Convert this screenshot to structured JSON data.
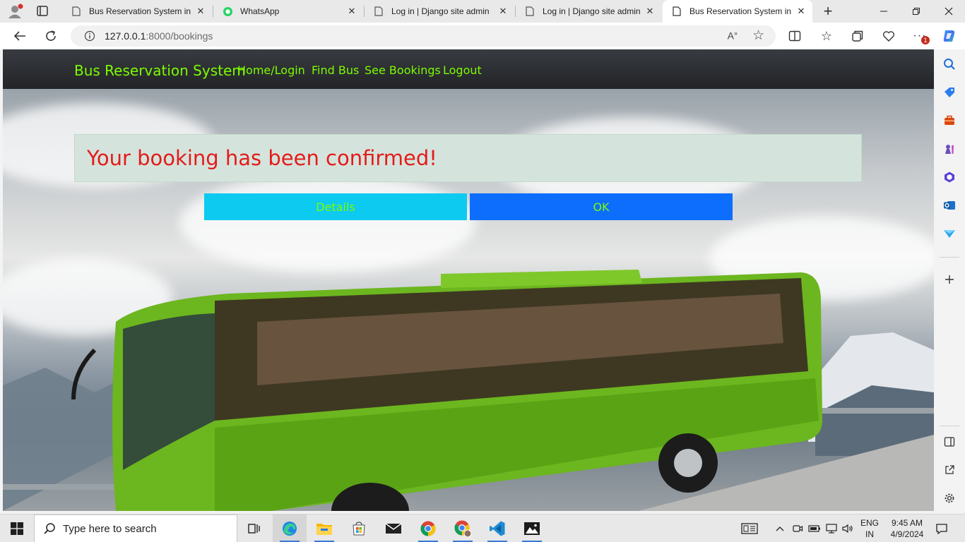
{
  "browser": {
    "tabs": [
      {
        "title": "Bus Reservation System in Dj",
        "icon": "page-icon",
        "active": false
      },
      {
        "title": "WhatsApp",
        "icon": "whatsapp-icon",
        "active": false
      },
      {
        "title": "Log in | Django site admin",
        "icon": "page-icon",
        "active": false
      },
      {
        "title": "Log in | Django site admin",
        "icon": "page-icon",
        "active": false
      },
      {
        "title": "Bus Reservation System in Dj",
        "icon": "page-icon",
        "active": true
      }
    ],
    "new_tab_symbol": "+",
    "url_host": "127.0.0.1",
    "url_path": ":8000/bookings",
    "notification_badge": "1"
  },
  "site": {
    "brand": "Bus Reservation System",
    "nav": [
      "Home/Login",
      "Find Bus",
      "See Bookings",
      "Logout"
    ],
    "nav_color": "#7cfc00"
  },
  "booking": {
    "message": "Your booking has been confirmed!",
    "message_color": "#e41b1b",
    "details_label": "Details",
    "ok_label": "OK",
    "details_color": "#0dcaf0",
    "ok_color": "#0d6efd"
  },
  "taskbar": {
    "search_placeholder": "Type here to search",
    "lang_line1": "ENG",
    "lang_line2": "IN",
    "time": "9:45 AM",
    "date": "4/9/2024"
  }
}
